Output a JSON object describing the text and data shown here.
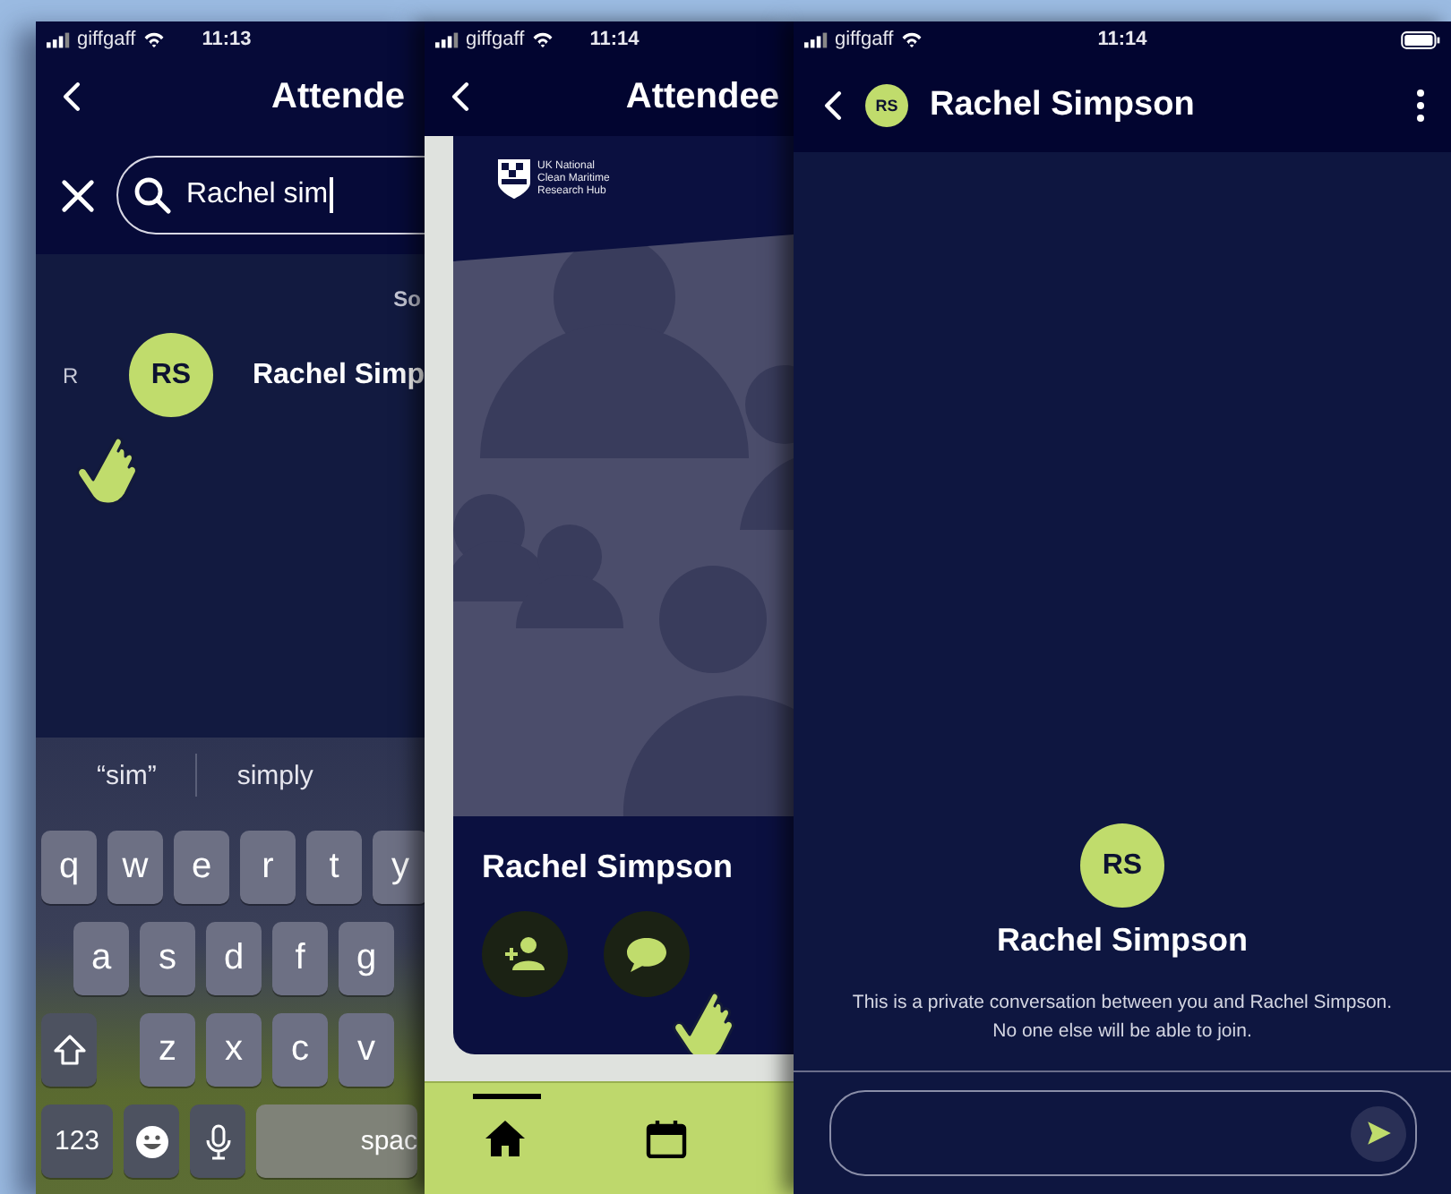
{
  "phones": [
    {
      "kind": "search",
      "status": {
        "carrier": "giffgaff",
        "time": "11:13"
      },
      "title": "Attende",
      "search": {
        "value": "Rachel sim"
      },
      "section_label": "So",
      "results": [
        {
          "index_letter": "R",
          "initials": "RS",
          "name": "Rachel Simp"
        }
      ],
      "suggestions": [
        "“sim”",
        "simply"
      ],
      "key_rows": [
        [
          "q",
          "w",
          "e",
          "r",
          "t",
          "y"
        ],
        [
          "a",
          "s",
          "d",
          "f",
          "g"
        ],
        [
          "z",
          "x",
          "c",
          "v"
        ]
      ],
      "bottom_keys": {
        "numbers": "123",
        "space": "spac"
      }
    },
    {
      "kind": "profile",
      "status": {
        "carrier": "giffgaff",
        "time": "11:14"
      },
      "title": "Attendee",
      "logo_lines": [
        "UK National",
        "Clean Maritime",
        "Research Hub"
      ],
      "name": "Rachel Simpson",
      "nav": [
        {
          "kind": "home",
          "selected": true
        },
        {
          "kind": "calendar",
          "selected": false
        }
      ]
    },
    {
      "kind": "chat",
      "status": {
        "carrier": "giffgaff",
        "time": "11:14"
      },
      "contact": {
        "initials": "RS",
        "name": "Rachel Simpson"
      },
      "intro": {
        "initials": "RS",
        "name": "Rachel Simpson",
        "note_lines": [
          "This is a private conversation between you and Rachel Simpson.",
          "No one else will be able to join."
        ]
      }
    }
  ]
}
